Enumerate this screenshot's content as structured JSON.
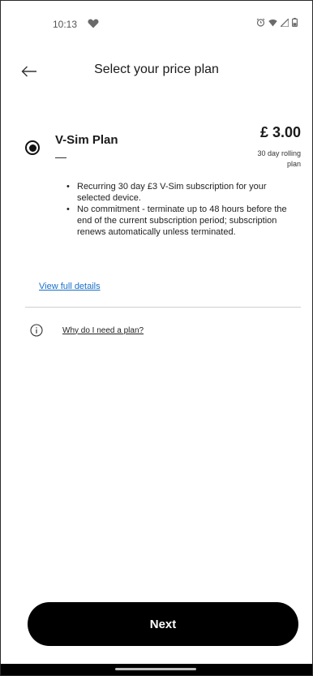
{
  "status_bar": {
    "time": "10:13",
    "left_icon": "heart-icon",
    "right_icons": [
      "alarm-icon",
      "wifi-icon",
      "signal-icon",
      "battery-icon"
    ]
  },
  "header": {
    "back_icon": "back-arrow-icon",
    "title": "Select your price plan"
  },
  "plan": {
    "selected": true,
    "name": "V-Sim Plan",
    "price": "£ 3.00",
    "term": "30 day rolling plan",
    "features": [
      "Recurring 30 day £3 V-Sim subscription for your selected device.",
      "No commitment - terminate up to 48 hours before the end of the current subscription period; subscription renews automatically unless terminated."
    ],
    "details_link": "View full details"
  },
  "info": {
    "icon": "info-icon",
    "link": "Why do I need a plan?"
  },
  "actions": {
    "next_label": "Next"
  },
  "colors": {
    "primary_button": "#000000",
    "link": "#1a6fc9",
    "divider": "#cfcfcf"
  }
}
